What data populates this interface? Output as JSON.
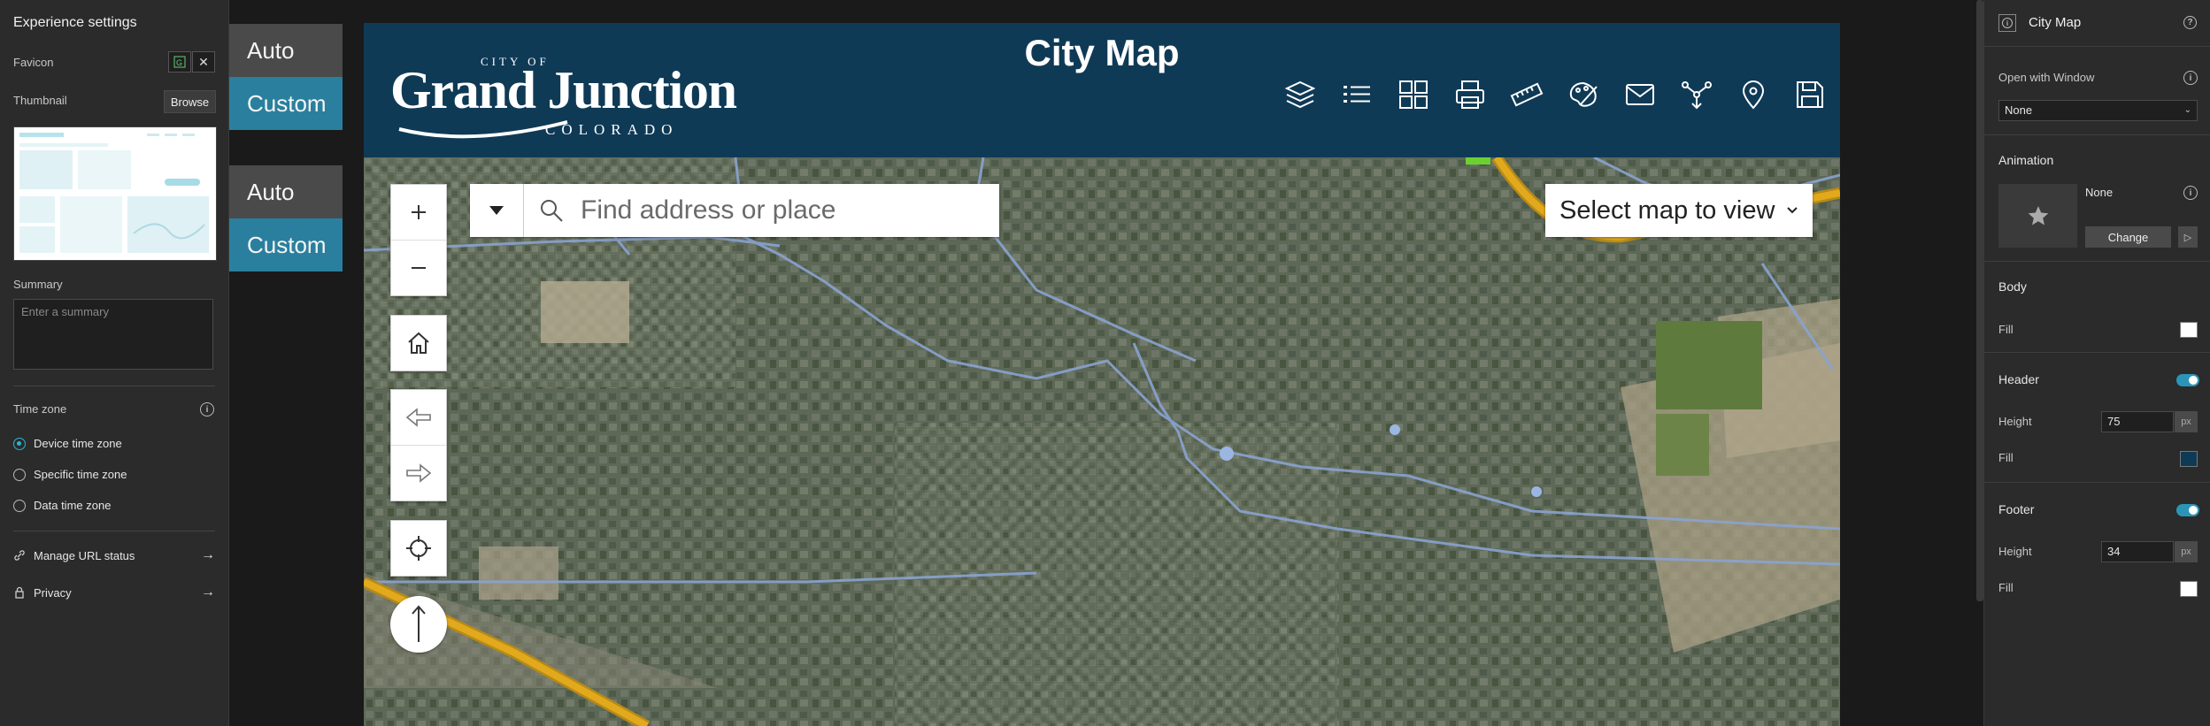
{
  "left_panel": {
    "title": "Experience settings",
    "favicon_label": "Favicon",
    "thumbnail_label": "Thumbnail",
    "browse_label": "Browse",
    "summary_label": "Summary",
    "summary_placeholder": "Enter a summary",
    "timezone_label": "Time zone",
    "timezone_options": [
      "Device time zone",
      "Specific time zone",
      "Data time zone"
    ],
    "timezone_selected": "Device time zone",
    "manage_url_label": "Manage URL status",
    "privacy_label": "Privacy"
  },
  "mode_toggles": [
    {
      "auto": "Auto",
      "custom": "Custom"
    },
    {
      "auto": "Auto",
      "custom": "Custom"
    }
  ],
  "canvas": {
    "site_title": "City Map",
    "logo": {
      "line1": "CITY OF",
      "line2": "Grand Junction",
      "line3": "COLORADO"
    },
    "header_tools": [
      "layers-icon",
      "legend-list-icon",
      "basemap-gallery-icon",
      "print-icon",
      "measure-icon",
      "draw-icon",
      "share-email-icon",
      "select-icon",
      "locate-pin-icon",
      "save-icon"
    ],
    "search_placeholder": "Find address or place",
    "select_map_label": "Select map to view"
  },
  "right_panel": {
    "page_name": "City Map",
    "open_with_window_label": "Open with Window",
    "open_with_window_value": "None",
    "animation_label": "Animation",
    "animation_value": "None",
    "change_label": "Change",
    "body_label": "Body",
    "fill_label": "Fill",
    "body_fill": "#ffffff",
    "header_label": "Header",
    "header_enabled": true,
    "height_label": "Height",
    "header_height": "75",
    "header_fill": "#0f3a56",
    "footer_label": "Footer",
    "footer_enabled": true,
    "footer_height": "34",
    "footer_fill": "#ffffff",
    "unit": "px"
  },
  "colors": {
    "accent": "#2a7f9e",
    "header_bg": "#0f3a56",
    "panel_bg": "#2b2b2b"
  }
}
